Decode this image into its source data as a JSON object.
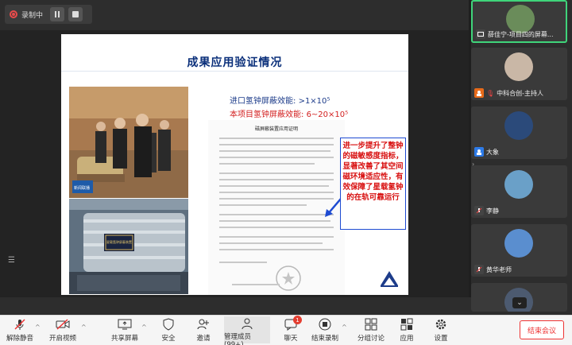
{
  "recording": {
    "label": "录制中"
  },
  "slide": {
    "title": "成果应用验证情况",
    "stat1_label": "进口氢钟屏蔽效能:",
    "stat1_value": ">1×10⁵",
    "stat2_label": "本项目氢钟屏蔽效能:",
    "stat2_value": "6~20×10⁵",
    "document_title": "磁屏蔽装置应用证明",
    "callout": "进一步提升了整钟的磁敏感度指标，显著改善了其空间磁环境适应性，有效保障了星载氢钟的在轨可靠运行",
    "photo_caption_tv": "新闻联播",
    "plate_text": "星载氢钟屏蔽装置"
  },
  "participants": [
    {
      "name": "薛佳宁-项目四的屏幕..."
    },
    {
      "name": "中科合创-主持人"
    },
    {
      "name": "大象"
    },
    {
      "name": "李静"
    },
    {
      "name": "黄华老师"
    }
  ],
  "toolbar": {
    "mute": "解除静音",
    "video": "开启视频",
    "share": "共享屏幕",
    "security": "安全",
    "invite": "邀请",
    "members": "管理成员(99+)",
    "chat": "聊天",
    "chat_badge": "1",
    "record": "结束录制",
    "breakout": "分组讨论",
    "apps": "应用",
    "settings": "设置",
    "end": "结束会议"
  }
}
